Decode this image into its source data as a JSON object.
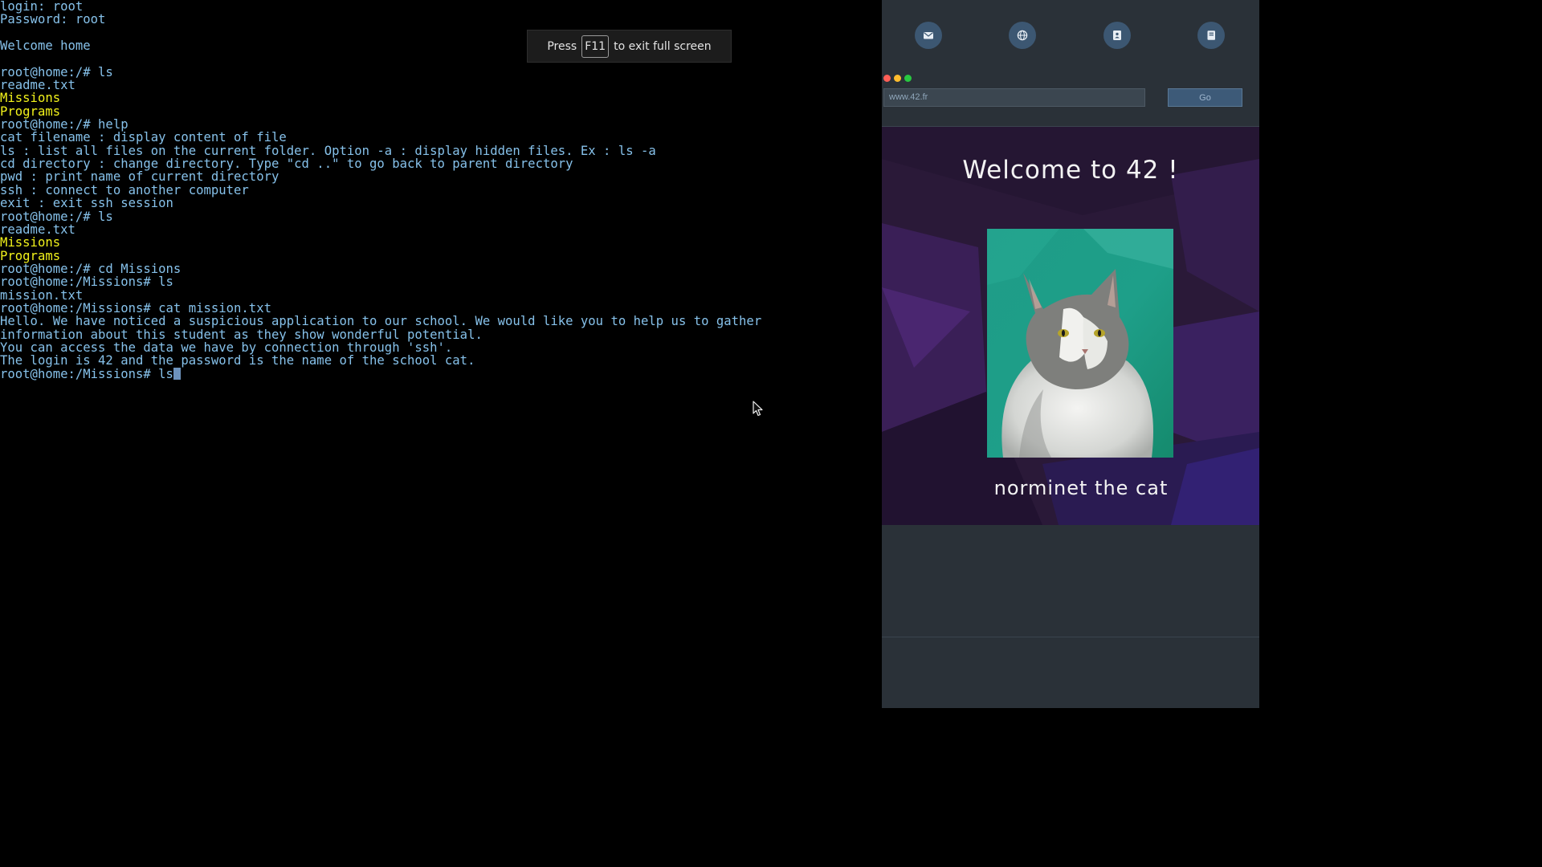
{
  "terminal": {
    "lines": [
      {
        "text": "login: root",
        "kind": "normal"
      },
      {
        "text": "Password: root",
        "kind": "normal"
      },
      {
        "text": "",
        "kind": "normal"
      },
      {
        "text": "Welcome home",
        "kind": "normal"
      },
      {
        "text": "",
        "kind": "normal"
      },
      {
        "text": "root@home:/# ls",
        "kind": "normal"
      },
      {
        "text": "readme.txt",
        "kind": "normal"
      },
      {
        "text": "Missions",
        "kind": "dir"
      },
      {
        "text": "Programs",
        "kind": "dir"
      },
      {
        "text": "root@home:/# help",
        "kind": "normal"
      },
      {
        "text": "cat filename : display content of file",
        "kind": "normal"
      },
      {
        "text": "ls : list all files on the current folder. Option -a : display hidden files. Ex : ls -a",
        "kind": "normal"
      },
      {
        "text": "cd directory : change directory. Type \"cd ..\" to go back to parent directory",
        "kind": "normal"
      },
      {
        "text": "pwd : print name of current directory",
        "kind": "normal"
      },
      {
        "text": "ssh : connect to another computer",
        "kind": "normal"
      },
      {
        "text": "exit : exit ssh session",
        "kind": "normal"
      },
      {
        "text": "root@home:/# ls",
        "kind": "normal"
      },
      {
        "text": "readme.txt",
        "kind": "normal"
      },
      {
        "text": "Missions",
        "kind": "dir"
      },
      {
        "text": "Programs",
        "kind": "dir"
      },
      {
        "text": "root@home:/# cd Missions",
        "kind": "normal"
      },
      {
        "text": "root@home:/Missions# ls",
        "kind": "normal"
      },
      {
        "text": "mission.txt",
        "kind": "normal"
      },
      {
        "text": "root@home:/Missions# cat mission.txt",
        "kind": "normal"
      },
      {
        "text": "Hello. We have noticed a suspicious application to our school. We would like you to help us to gather",
        "kind": "normal"
      },
      {
        "text": "information about this student as they show wonderful potential.",
        "kind": "normal"
      },
      {
        "text": "You can access the data we have by connection through 'ssh'.",
        "kind": "normal"
      },
      {
        "text": "The login is 42 and the password is the name of the school cat.",
        "kind": "normal"
      }
    ],
    "current_input": "root@home:/Missions# ls",
    "colors": {
      "text": "#86c1ea",
      "directory": "#f2f21b",
      "background": "#000000"
    }
  },
  "fullscreen_notice": {
    "prefix": "Press",
    "key": "F11",
    "suffix": "to exit full screen"
  },
  "dock": {
    "buttons": [
      {
        "icon": "mail-icon"
      },
      {
        "icon": "globe-icon"
      },
      {
        "icon": "contact-icon"
      },
      {
        "icon": "book-icon"
      }
    ],
    "color": "#3c5772"
  },
  "browser": {
    "window_controls": [
      {
        "name": "close",
        "color": "#ff5f57"
      },
      {
        "name": "minimize",
        "color": "#febc2e"
      },
      {
        "name": "maximize",
        "color": "#28c840"
      }
    ],
    "url": "www.42.fr",
    "go_label": "Go",
    "page": {
      "title": "Welcome to 42 !",
      "image_subject": "cat",
      "caption": "norminet the cat"
    }
  }
}
